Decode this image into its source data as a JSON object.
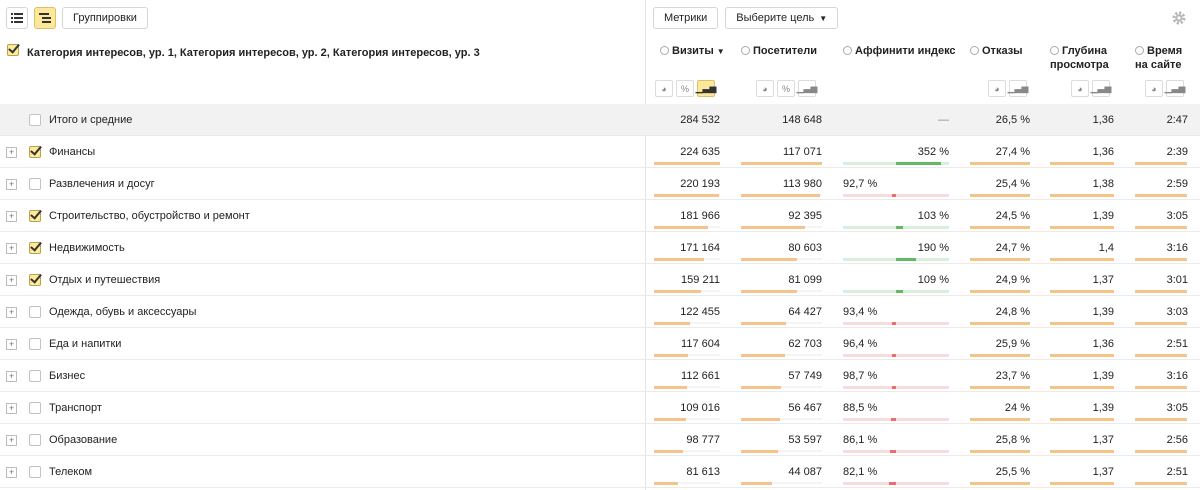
{
  "toolbar": {
    "group_label": "Группировки",
    "metrics_label": "Метрики",
    "goal_label": "Выберите цель"
  },
  "header": {
    "dimension_title": "Категория интересов, ур. 1, Категория интересов, ур. 2, Категория интересов, ур. 3",
    "columns": [
      {
        "line1": "Визиты",
        "line2": "",
        "sort": "▼"
      },
      {
        "line1": "Посетители",
        "line2": ""
      },
      {
        "line1": "Аффинити индекс",
        "line2": ""
      },
      {
        "line1": "Отказы",
        "line2": ""
      },
      {
        "line1": "Глубина",
        "line2": "просмотра"
      },
      {
        "line1": "Время",
        "line2": "на сайте"
      }
    ],
    "mini_percent": "%"
  },
  "total": {
    "label": "Итого и средние",
    "visits": "284 532",
    "visitors": "148 648",
    "affinity": "—",
    "bounce": "26,5 %",
    "depth": "1,36",
    "time": "2:47"
  },
  "rows": [
    {
      "label": "Финансы",
      "checked": true,
      "visits": "224 635",
      "visitors": "117 071",
      "affinity": "352 %",
      "aff_val": 352,
      "bounce": "27,4 %",
      "depth": "1,36",
      "time": "2:39",
      "v_frac": 1.0,
      "vis_frac": 1.0
    },
    {
      "label": "Развлечения и досуг",
      "checked": false,
      "visits": "220 193",
      "visitors": "113 980",
      "affinity": "92,7 %",
      "aff_val": 92.7,
      "bounce": "25,4 %",
      "depth": "1,38",
      "time": "2:59",
      "v_frac": 0.98,
      "vis_frac": 0.97
    },
    {
      "label": "Строительство, обустройство и ремонт",
      "checked": true,
      "visits": "181 966",
      "visitors": "92 395",
      "affinity": "103 %",
      "aff_val": 103,
      "bounce": "24,5 %",
      "depth": "1,39",
      "time": "3:05",
      "v_frac": 0.81,
      "vis_frac": 0.79
    },
    {
      "label": "Недвижимость",
      "checked": true,
      "visits": "171 164",
      "visitors": "80 603",
      "affinity": "190 %",
      "aff_val": 190,
      "bounce": "24,7 %",
      "depth": "1,4",
      "time": "3:16",
      "v_frac": 0.76,
      "vis_frac": 0.69
    },
    {
      "label": "Отдых и путешествия",
      "checked": true,
      "visits": "159 211",
      "visitors": "81 099",
      "affinity": "109 %",
      "aff_val": 109,
      "bounce": "24,9 %",
      "depth": "1,37",
      "time": "3:01",
      "v_frac": 0.71,
      "vis_frac": 0.69
    },
    {
      "label": "Одежда, обувь и аксессуары",
      "checked": false,
      "visits": "122 455",
      "visitors": "64 427",
      "affinity": "93,4 %",
      "aff_val": 93.4,
      "bounce": "24,8 %",
      "depth": "1,39",
      "time": "3:03",
      "v_frac": 0.55,
      "vis_frac": 0.55
    },
    {
      "label": "Еда и напитки",
      "checked": false,
      "visits": "117 604",
      "visitors": "62 703",
      "affinity": "96,4 %",
      "aff_val": 96.4,
      "bounce": "25,9 %",
      "depth": "1,36",
      "time": "2:51",
      "v_frac": 0.52,
      "vis_frac": 0.54
    },
    {
      "label": "Бизнес",
      "checked": false,
      "visits": "112 661",
      "visitors": "57 749",
      "affinity": "98,7 %",
      "aff_val": 98.7,
      "bounce": "23,7 %",
      "depth": "1,39",
      "time": "3:16",
      "v_frac": 0.5,
      "vis_frac": 0.49
    },
    {
      "label": "Транспорт",
      "checked": false,
      "visits": "109 016",
      "visitors": "56 467",
      "affinity": "88,5 %",
      "aff_val": 88.5,
      "bounce": "24 %",
      "depth": "1,39",
      "time": "3:05",
      "v_frac": 0.49,
      "vis_frac": 0.48
    },
    {
      "label": "Образование",
      "checked": false,
      "visits": "98 777",
      "visitors": "53 597",
      "affinity": "86,1 %",
      "aff_val": 86.1,
      "bounce": "25,8 %",
      "depth": "1,37",
      "time": "2:56",
      "v_frac": 0.44,
      "vis_frac": 0.46
    },
    {
      "label": "Телеком",
      "checked": false,
      "visits": "81 613",
      "visitors": "44 087",
      "affinity": "82,1 %",
      "aff_val": 82.1,
      "bounce": "25,5 %",
      "depth": "1,37",
      "time": "2:51",
      "v_frac": 0.36,
      "vis_frac": 0.38
    }
  ],
  "colors": {
    "bar": "#f6c48a",
    "affinity_positive": "#63b863",
    "affinity_positive_bg": "#d9efd9",
    "affinity_negative": "#e8706c",
    "affinity_negative_bg": "#f7dcdc",
    "accent": "#fbe89b"
  }
}
